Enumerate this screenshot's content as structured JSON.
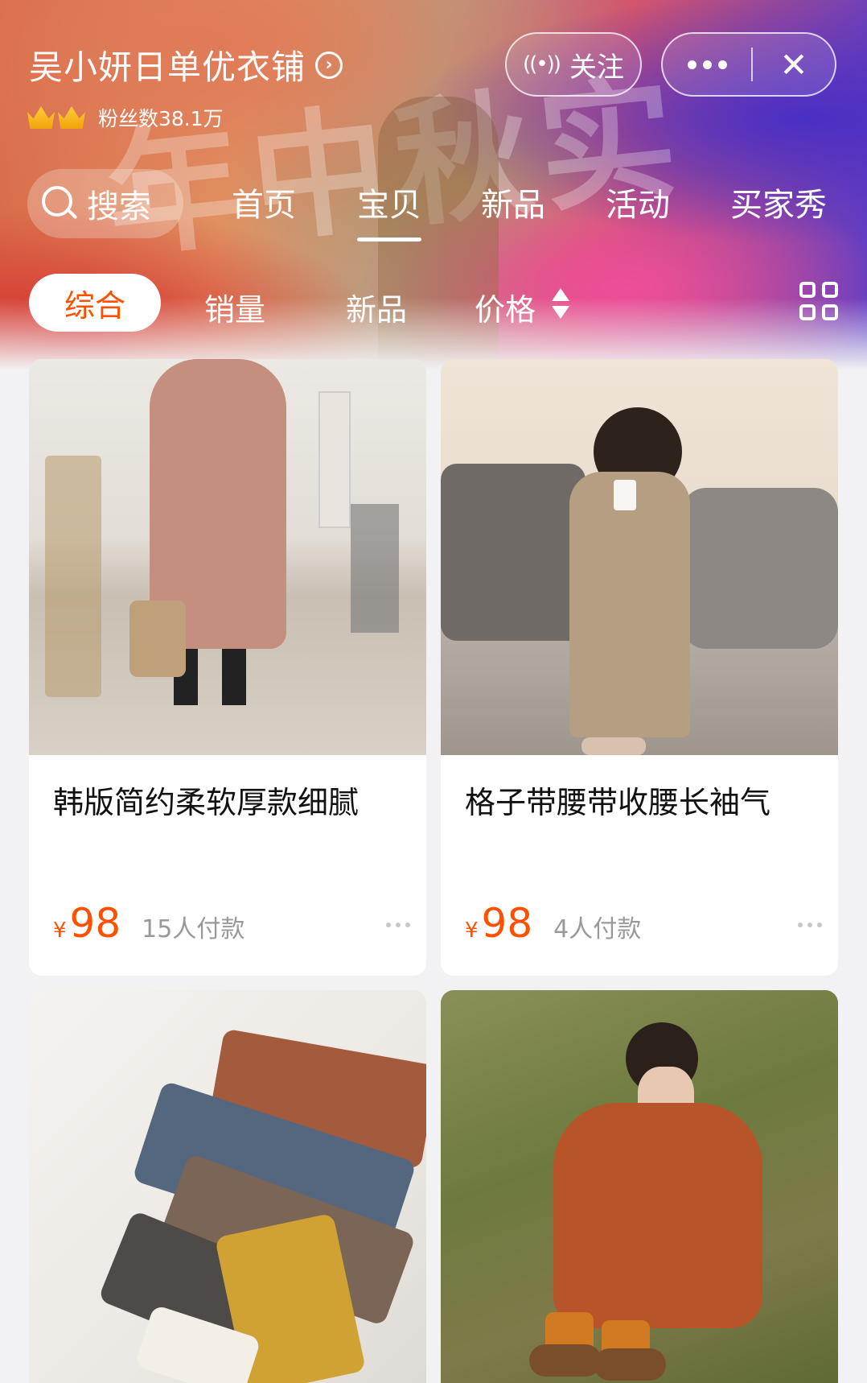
{
  "shop": {
    "name": "吴小妍日单优衣铺",
    "fans": "粉丝数38.1万",
    "follow_label": "关注"
  },
  "banner": {
    "art_text": "年中秋实"
  },
  "nav": {
    "search_label": "搜索",
    "tabs": [
      "首页",
      "宝贝",
      "新品",
      "活动",
      "买家秀"
    ],
    "active_tab": "宝贝"
  },
  "filters": {
    "items": [
      "综合",
      "销量",
      "新品",
      "价格"
    ],
    "active": "综合"
  },
  "products": [
    {
      "title": "韩版简约柔软厚款细腻",
      "currency": "¥",
      "price": "98",
      "sold": "15人付款"
    },
    {
      "title": "格子带腰带收腰长袖气",
      "currency": "¥",
      "price": "98",
      "sold": "4人付款"
    }
  ],
  "colors": {
    "accent": "#ff5000",
    "text_primary": "#111111",
    "text_muted": "#999999",
    "page_bg": "#f2f2f4"
  },
  "icons": {
    "shop_arrow": "chevron-right-circle-icon",
    "follow": "broadcast-icon",
    "more": "more-dots-icon",
    "close": "close-icon",
    "search": "search-icon",
    "sort": "sort-updown-icon",
    "layout": "grid-layout-icon",
    "crown": "crown-icon"
  }
}
